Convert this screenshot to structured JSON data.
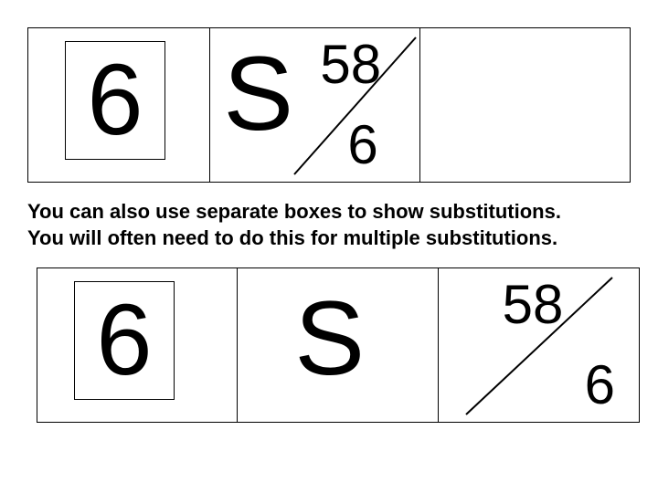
{
  "row1": {
    "player_number": "6",
    "s_label": "S",
    "sub_top": "58",
    "sub_bot": "6"
  },
  "caption": {
    "line1": "You can also use separate boxes to show substitutions.",
    "line2": "You will often need to do this for multiple substitutions."
  },
  "row2": {
    "player_number": "6",
    "s_label": "S",
    "sub_top": "58",
    "sub_bot": "6"
  }
}
